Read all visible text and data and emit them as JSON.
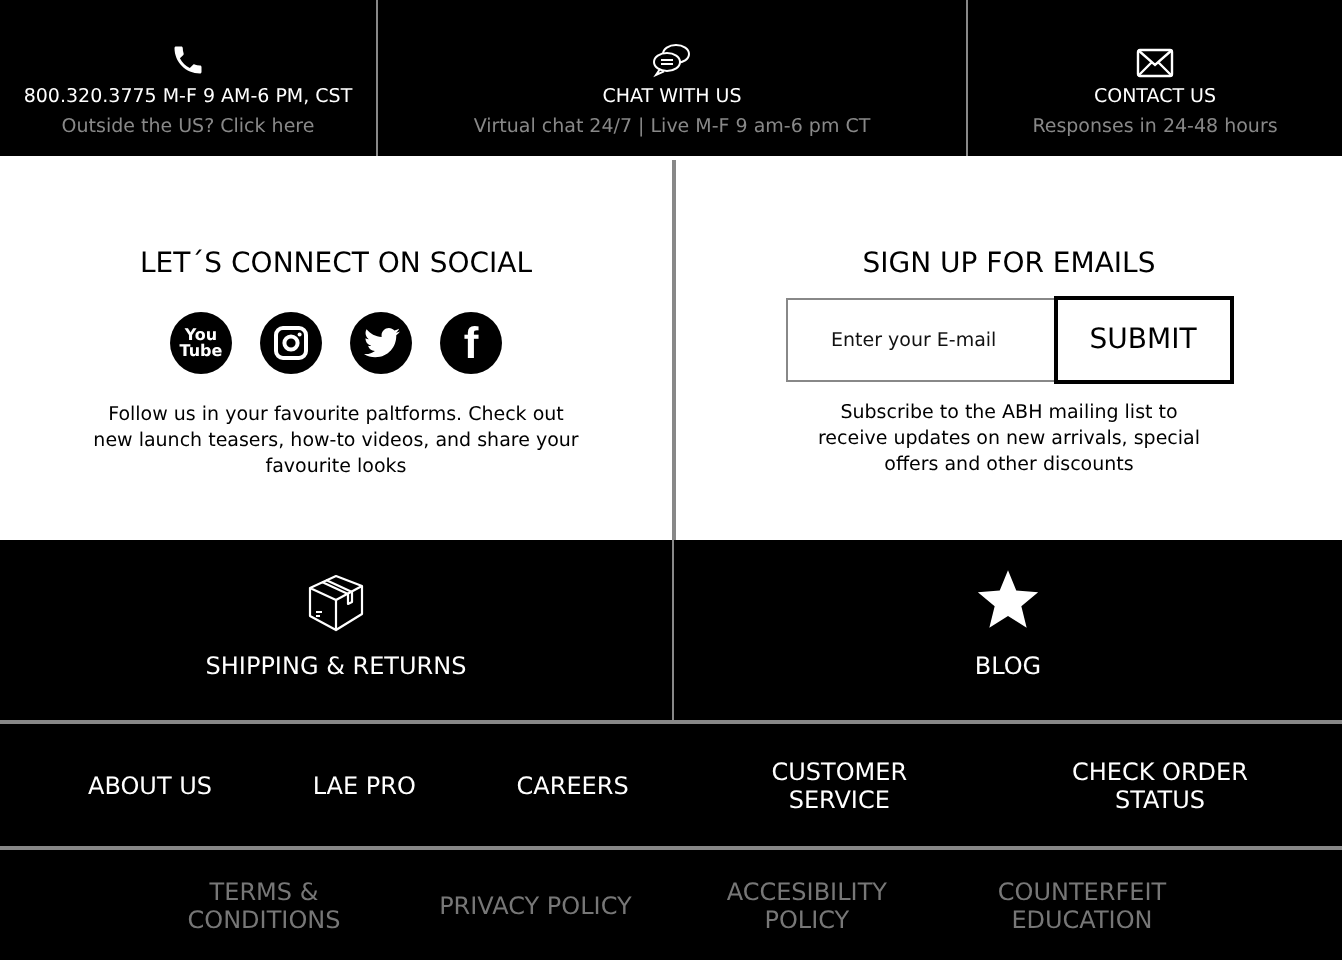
{
  "contact_bar": [
    {
      "kind": "phone",
      "title": "800.320.3775 M-F  9 AM-6 PM, CST",
      "subtitle": "Outside the US? Click here"
    },
    {
      "kind": "chat",
      "title": "CHAT WITH US",
      "subtitle": "Virtual chat 24/7  |  Live M-F 9 am-6 pm CT"
    },
    {
      "kind": "mail",
      "title": "CONTACT US",
      "subtitle": "Responses in 24-48 hours"
    }
  ],
  "social": {
    "heading": "LET´S CONNECT ON SOCIAL",
    "icons": [
      {
        "kind": "youtube",
        "glyph": [
          "You",
          "Tube"
        ]
      },
      {
        "kind": "instagram"
      },
      {
        "kind": "twitter"
      },
      {
        "kind": "facebook",
        "glyph": [
          "f"
        ]
      }
    ],
    "text": "Follow us in your favourite paltforms. Check out new launch teasers, how-to videos, and share your favourite looks"
  },
  "newsletter": {
    "heading": "SIGN UP FOR EMAILS",
    "placeholder": "Enter your E-mail",
    "button": "SUBMIT",
    "text": "Subscribe to the ABH mailing list to receive updates on new arrivals, special offers and other discounts"
  },
  "feature_links": [
    {
      "kind": "box",
      "label": "SHIPPING & RETURNS"
    },
    {
      "kind": "star",
      "label": "BLOG"
    }
  ],
  "nav_links": [
    "ABOUT US",
    "LAE PRO",
    "CAREERS",
    "CUSTOMER SERVICE",
    "CHECK ORDER STATUS"
  ],
  "legal_links": [
    "TERMS & CONDITIONS",
    "PRIVACY POLICY",
    "ACCESIBILITY POLICY",
    "COUNTERFEIT EDUCATION"
  ]
}
